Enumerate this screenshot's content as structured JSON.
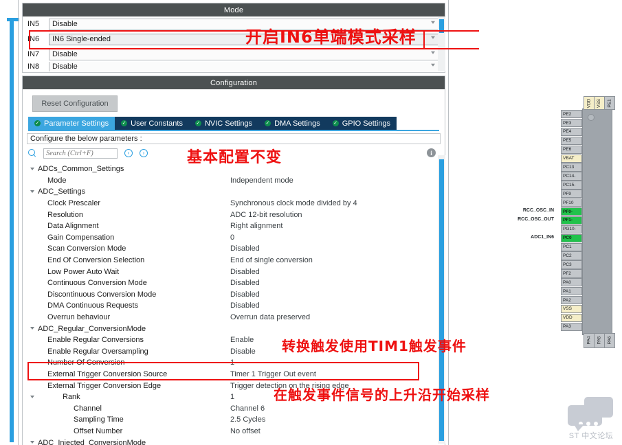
{
  "mode_panel": {
    "title": "Mode",
    "rows": [
      {
        "label": "IN5",
        "value": "Disable"
      },
      {
        "label": "IN6",
        "value": "IN6 Single-ended"
      },
      {
        "label": "IN7",
        "value": "Disable"
      },
      {
        "label": "IN8",
        "value": "Disable"
      }
    ]
  },
  "config_panel": {
    "title": "Configuration",
    "reset_label": "Reset Configuration",
    "tabs": [
      {
        "label": "Parameter Settings",
        "active": true
      },
      {
        "label": "User Constants",
        "active": false
      },
      {
        "label": "NVIC Settings",
        "active": false
      },
      {
        "label": "DMA Settings",
        "active": false
      },
      {
        "label": "GPIO Settings",
        "active": false
      }
    ],
    "configure_banner": "Configure the below parameters :",
    "search": {
      "placeholder": "Search (Ctrl+F)",
      "value": "",
      "prev_label": "‹",
      "next_label": "›"
    },
    "info_label": "i",
    "tree": [
      {
        "indent": 0,
        "twisty": true,
        "name": "ADCs_Common_Settings",
        "value": ""
      },
      {
        "indent": 1,
        "twisty": false,
        "name": "Mode",
        "value": "Independent mode"
      },
      {
        "indent": 0,
        "twisty": true,
        "name": "ADC_Settings",
        "value": ""
      },
      {
        "indent": 1,
        "twisty": false,
        "name": "Clock Prescaler",
        "value": "Synchronous clock mode divided by 4"
      },
      {
        "indent": 1,
        "twisty": false,
        "name": "Resolution",
        "value": "ADC 12-bit resolution"
      },
      {
        "indent": 1,
        "twisty": false,
        "name": "Data Alignment",
        "value": "Right alignment"
      },
      {
        "indent": 1,
        "twisty": false,
        "name": "Gain Compensation",
        "value": "0"
      },
      {
        "indent": 1,
        "twisty": false,
        "name": "Scan Conversion Mode",
        "value": "Disabled"
      },
      {
        "indent": 1,
        "twisty": false,
        "name": "End Of Conversion Selection",
        "value": "End of single conversion"
      },
      {
        "indent": 1,
        "twisty": false,
        "name": "Low Power Auto Wait",
        "value": "Disabled"
      },
      {
        "indent": 1,
        "twisty": false,
        "name": "Continuous Conversion Mode",
        "value": "Disabled"
      },
      {
        "indent": 1,
        "twisty": false,
        "name": "Discontinuous Conversion Mode",
        "value": "Disabled"
      },
      {
        "indent": 1,
        "twisty": false,
        "name": "DMA Continuous Requests",
        "value": "Disabled"
      },
      {
        "indent": 1,
        "twisty": false,
        "name": "Overrun behaviour",
        "value": "Overrun data preserved"
      },
      {
        "indent": 0,
        "twisty": true,
        "name": "ADC_Regular_ConversionMode",
        "value": ""
      },
      {
        "indent": 1,
        "twisty": false,
        "name": "Enable Regular Conversions",
        "value": "Enable"
      },
      {
        "indent": 1,
        "twisty": false,
        "name": "Enable Regular Oversampling",
        "value": "Disable"
      },
      {
        "indent": 1,
        "twisty": false,
        "name": "Number Of Conversion",
        "value": "1"
      },
      {
        "indent": 1,
        "twisty": false,
        "name": "External Trigger Conversion Source",
        "value": "Timer 1 Trigger Out event"
      },
      {
        "indent": 1,
        "twisty": false,
        "name": "External Trigger Conversion Edge",
        "value": "Trigger detection on the rising edge"
      },
      {
        "indent": 2,
        "twisty": true,
        "name": "Rank",
        "value": "1"
      },
      {
        "indent": 3,
        "twisty": false,
        "name": "Channel",
        "value": "Channel 6"
      },
      {
        "indent": 3,
        "twisty": false,
        "name": "Sampling Time",
        "value": "2.5 Cycles"
      },
      {
        "indent": 3,
        "twisty": false,
        "name": "Offset Number",
        "value": "No offset"
      },
      {
        "indent": 0,
        "twisty": true,
        "name": "ADC_Injected_ConversionMode",
        "value": ""
      }
    ]
  },
  "annotations": [
    {
      "id": "ann-in6",
      "text": "开启IN6单端模式采样"
    },
    {
      "id": "ann-basic",
      "text": "基本配置不变"
    },
    {
      "id": "ann-trigger",
      "text": "转换触发使用TIM1触发事件"
    },
    {
      "id": "ann-edge",
      "text": "在触发事件信号的上升沿开始采样"
    }
  ],
  "chip": {
    "top_pins": [
      {
        "label": "VDD",
        "kind": "pwr"
      },
      {
        "label": "VSS",
        "kind": "pwr"
      },
      {
        "label": "PE1",
        "kind": "io"
      }
    ],
    "left_pins": [
      {
        "label": "PE2",
        "kind": "io",
        "signal": ""
      },
      {
        "label": "PE3",
        "kind": "io",
        "signal": ""
      },
      {
        "label": "PE4",
        "kind": "io",
        "signal": ""
      },
      {
        "label": "PE5",
        "kind": "io",
        "signal": ""
      },
      {
        "label": "PE6",
        "kind": "io",
        "signal": ""
      },
      {
        "label": "VBAT",
        "kind": "vbat",
        "signal": ""
      },
      {
        "label": "PC13",
        "kind": "io",
        "signal": ""
      },
      {
        "label": "PC14-",
        "kind": "io",
        "signal": ""
      },
      {
        "label": "PC15-",
        "kind": "io",
        "signal": ""
      },
      {
        "label": "PF9",
        "kind": "io",
        "signal": ""
      },
      {
        "label": "PF10",
        "kind": "io",
        "signal": ""
      },
      {
        "label": "PF0-",
        "kind": "green",
        "signal": "RCC_OSC_IN"
      },
      {
        "label": "PF1-",
        "kind": "green",
        "signal": "RCC_OSC_OUT"
      },
      {
        "label": "PG10-",
        "kind": "io",
        "signal": ""
      },
      {
        "label": "PC0",
        "kind": "green",
        "signal": "ADC1_IN6"
      },
      {
        "label": "PC1",
        "kind": "io",
        "signal": ""
      },
      {
        "label": "PC2",
        "kind": "io",
        "signal": ""
      },
      {
        "label": "PC3",
        "kind": "io",
        "signal": ""
      },
      {
        "label": "PF2",
        "kind": "io",
        "signal": ""
      },
      {
        "label": "PA0",
        "kind": "io",
        "signal": ""
      },
      {
        "label": "PA1",
        "kind": "io",
        "signal": ""
      },
      {
        "label": "PA2",
        "kind": "io",
        "signal": ""
      },
      {
        "label": "VSS",
        "kind": "pwr",
        "signal": ""
      },
      {
        "label": "VDD",
        "kind": "pwr",
        "signal": ""
      },
      {
        "label": "PA3",
        "kind": "io",
        "signal": ""
      }
    ],
    "bottom_pins": [
      {
        "label": "PA4",
        "kind": "io"
      },
      {
        "label": "PA5",
        "kind": "io"
      },
      {
        "label": "PA6",
        "kind": "io"
      }
    ]
  },
  "watermark": {
    "text": "ST 中文论坛"
  },
  "colors": {
    "accent_blue": "#2a9fe0",
    "tab_active": "#3ba6e0",
    "tab_inactive": "#123a5e",
    "section_header": "#4c5152",
    "annotation_red": "#ee1111",
    "pin_green": "#21c24b",
    "pin_power": "#f5eec8"
  }
}
